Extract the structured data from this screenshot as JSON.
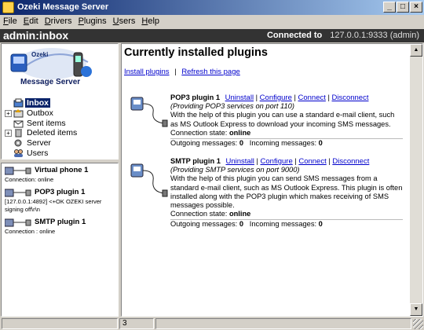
{
  "window": {
    "title": "Ozeki Message Server"
  },
  "menu": [
    "File",
    "Edit",
    "Drivers",
    "Plugins",
    "Users",
    "Help"
  ],
  "header": {
    "location": "admin:inbox",
    "connected_label": "Connected to",
    "connected_value": "127.0.0.1:9333 (admin)"
  },
  "logo": {
    "brand": "Ozeki",
    "product": "Message Server"
  },
  "tree": [
    {
      "label": "Inbox",
      "icon": "inbox-icon",
      "selected": true,
      "expander": ""
    },
    {
      "label": "Outbox",
      "icon": "outbox-icon",
      "selected": false,
      "expander": "+"
    },
    {
      "label": "Sent items",
      "icon": "sent-items-icon",
      "selected": false,
      "expander": ""
    },
    {
      "label": "Deleted items",
      "icon": "deleted-items-icon",
      "selected": false,
      "expander": "+"
    },
    {
      "label": "Server",
      "icon": "server-icon",
      "selected": false,
      "expander": ""
    },
    {
      "label": "Users",
      "icon": "users-icon",
      "selected": false,
      "expander": ""
    }
  ],
  "connections": [
    {
      "name": "Virtual phone 1",
      "info": "Connection: online"
    },
    {
      "name": "POP3 plugin 1",
      "info": "[127.0.0.1:4892] <+OK OZEKI server signing off\\r\\n"
    },
    {
      "name": "SMTP plugin 1",
      "info": "Connection : online"
    }
  ],
  "main": {
    "title": "Currently installed plugins",
    "install_link": "Install plugins",
    "sep": "|",
    "refresh_link": "Refresh this page",
    "plugins": [
      {
        "name": "POP3 plugin 1",
        "actions": [
          "Uninstall",
          "Configure",
          "Connect",
          "Disconnect"
        ],
        "providing": "(Providing POP3 services on port 110)",
        "description": "With the help of this plugin you can use a standard e-mail client, such as MS Outlook Express to download your incoming SMS messages.",
        "state_label": "Connection state:",
        "state_value": "online",
        "out_label": "Outgoing messages:",
        "out_value": "0",
        "in_label": "Incoming messages:",
        "in_value": "0"
      },
      {
        "name": "SMTP plugin 1",
        "actions": [
          "Uninstall",
          "Configure",
          "Connect",
          "Disconnect"
        ],
        "providing": "(Providing SMTP services on port 9000)",
        "description": "With the help of this plugin you can send SMS messages from a standard e-mail client, such as MS Outlook Express. This plugin is often installed along with the POP3 plugin which makes receiving of SMS messages possible.",
        "state_label": "Connection state:",
        "state_value": "online",
        "out_label": "Outgoing messages:",
        "out_value": "0",
        "in_label": "Incoming messages:",
        "in_value": "0"
      }
    ]
  },
  "status": {
    "count": "3"
  }
}
